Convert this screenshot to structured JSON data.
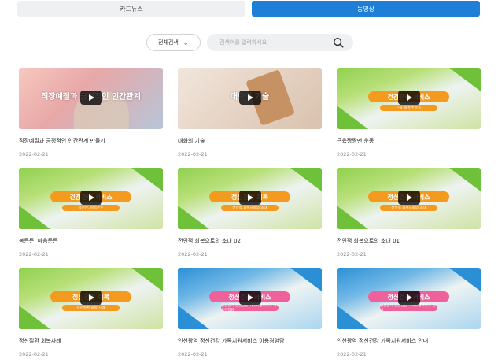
{
  "tabs": [
    {
      "label": "카드뉴스",
      "active": false
    },
    {
      "label": "동영상",
      "active": true
    }
  ],
  "search": {
    "select_label": "전체검색",
    "placeholder": "검색어를 입력하세요"
  },
  "colors": {
    "accent": "#1f7fd6"
  },
  "cards": [
    {
      "title": "직장예절과 긍정적인 인간관계 만들기",
      "date": "2022-02-21",
      "thumb_text": "직장예절과 긍정적인 인간관계",
      "thumb_style": "pink"
    },
    {
      "title": "대화의 기술",
      "date": "2022-02-21",
      "thumb_text": "대화의 기술",
      "thumb_style": "cup"
    },
    {
      "title": "근육짱짱맨 운동",
      "date": "2022-02-21",
      "thumb_text": "건강관리 서비스",
      "thumb_sub": "근육 짱짱맨 운동",
      "thumb_style": "green"
    },
    {
      "title": "봄든든, 마음든든",
      "date": "2022-02-21",
      "thumb_text": "건강관리 서비스",
      "thumb_sub": "봄든든, 마음든든",
      "thumb_style": "green"
    },
    {
      "title": "전인적 회복으로의 초대 02",
      "date": "2022-02-21",
      "thumb_text": "정신건강 회복",
      "thumb_sub": "전인적 회복으로의 초대",
      "thumb_style": "green"
    },
    {
      "title": "전인적 회복으로의 초대 01",
      "date": "2022-02-21",
      "thumb_text": "정신건강 서비스",
      "thumb_sub": "전인적 회복으로의 초대",
      "thumb_style": "green"
    },
    {
      "title": "정신질환 회복사례",
      "date": "2022-02-21",
      "thumb_text": "정신건강 회복",
      "thumb_sub": "정신질환 회복 사례",
      "thumb_style": "green"
    },
    {
      "title": "인천광역 정신건강 가족지원서비스 이용경험담",
      "date": "2022-02-21",
      "thumb_text": "정신건강 서비스",
      "thumb_sub": "인천광역 정신건강 가족지원서비스 이용경험담",
      "thumb_style": "blue"
    },
    {
      "title": "인천광역 정신건강 가족지원서비스 안내",
      "date": "2022-02-21",
      "thumb_text": "정신건강 서비스",
      "thumb_sub": "인천광역 정신건강 가족지원서비스 안내",
      "thumb_style": "blue"
    }
  ]
}
